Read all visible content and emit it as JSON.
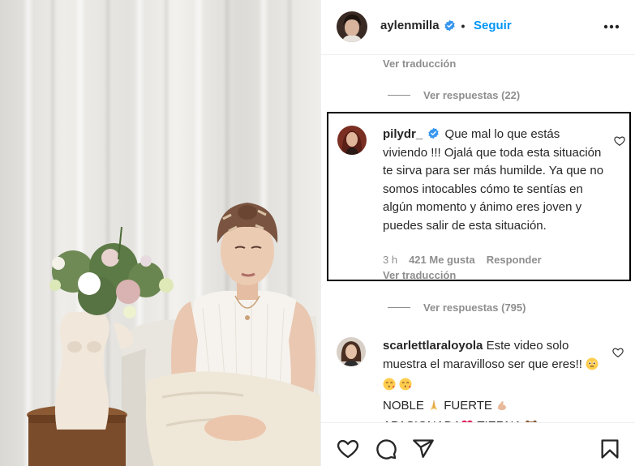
{
  "post": {
    "header": {
      "username": "aylenmilla",
      "verified": true,
      "separator": "•",
      "follow_label": "Seguir",
      "more_icon": "more-horizontal-icon"
    },
    "top": {
      "view_translation": "Ver traducción",
      "view_replies": "Ver respuestas (22)"
    },
    "comments": [
      {
        "username": "pilydr_",
        "verified": true,
        "text": "Que mal lo que estás viviendo !!! Ojalá que toda esta situación te sirva para ser más humilde. Ya que no somos intocables cómo te sentías en algún momento y ánimo eres joven y puedes salir de esta situación.",
        "time": "3 h",
        "likes": "421 Me gusta",
        "reply_label": "Responder",
        "view_translation": "Ver traducción",
        "view_replies": "Ver respuestas (795)"
      },
      {
        "username": "scarlettlaraloyola",
        "verified": false,
        "text_part1": "Este video solo muestra el maravilloso ser que eres!!",
        "line2": "NOBLE",
        "line2b": " FUERTE",
        "line3": "APASIONADA",
        "line3b": " TIERNA"
      }
    ],
    "actions": [
      "heart-icon",
      "comment-icon",
      "share-icon",
      "bookmark-icon"
    ],
    "colors": {
      "accent": "#0095f6",
      "text": "#262626",
      "muted": "#8e8e8e",
      "verified": "#3897f0"
    }
  }
}
